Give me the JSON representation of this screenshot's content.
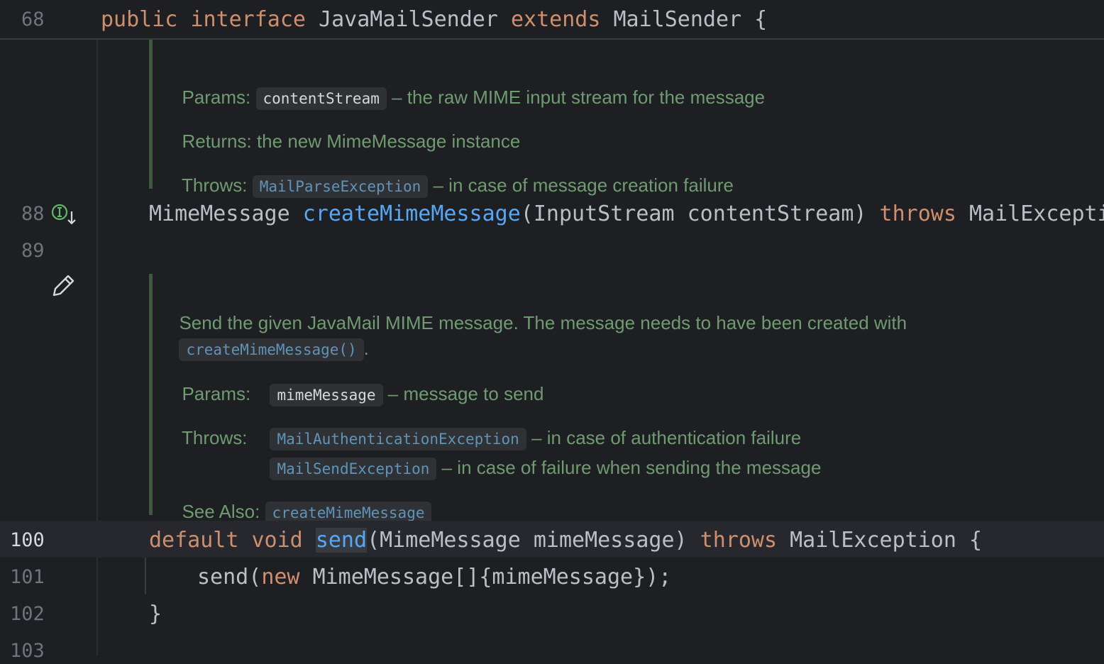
{
  "sticky_header": {
    "line_number": "68",
    "code": {
      "kw1": "public",
      "kw2": "interface",
      "name": "JavaMailSender",
      "kw3": "extends",
      "parent": "MailSender {"
    }
  },
  "doc1": {
    "params_label": "Params:",
    "param_name": "contentStream",
    "param_desc": "– the raw MIME input stream for the message",
    "returns_label": "Returns:",
    "returns_desc": "the new MimeMessage instance",
    "throws_label": "Throws:",
    "throws_exc": "MailParseException",
    "throws_desc": "– in case of message creation failure"
  },
  "line88": {
    "number": "88",
    "type": "MimeMessage",
    "method": "createMimeMessage",
    "args": "(InputStream contentStream)",
    "throws_kw": "throws",
    "exc": "MailException;"
  },
  "line89": {
    "number": "89"
  },
  "doc2": {
    "summary_line1": "Send the given JavaMail MIME message. The message needs to have been created with",
    "summary_link": "createMimeMessage()",
    "summary_end": ".",
    "params_label": "Params:",
    "param_name": "mimeMessage",
    "param_desc": "– message to send",
    "throws_label": "Throws:",
    "throws_exc1": "MailAuthenticationException",
    "throws_desc1": "– in case of authentication failure",
    "throws_exc2": "MailSendException",
    "throws_desc2": "– in case of failure when sending the message",
    "see_label": "See Also:",
    "see_link": "createMimeMessage"
  },
  "line100": {
    "number": "100",
    "kw_default": "default",
    "kw_void": "void",
    "method": "send",
    "args": "(MimeMessage mimeMessage)",
    "throws_kw": "throws",
    "exc": "MailException {"
  },
  "line101": {
    "number": "101",
    "call": "send(",
    "kw_new": "new",
    "rest": "MimeMessage[]{mimeMessage});"
  },
  "line102": {
    "number": "102",
    "brace": "}"
  },
  "line103": {
    "number": "103"
  },
  "icons": {
    "implements": "implemented-method-icon",
    "edit": "pencil-icon"
  },
  "colors": {
    "background": "#1e1f22",
    "keyword": "#cf8e6d",
    "function": "#56a8f5",
    "doc_text": "#6f9b71",
    "doc_link": "#5e94b8"
  }
}
